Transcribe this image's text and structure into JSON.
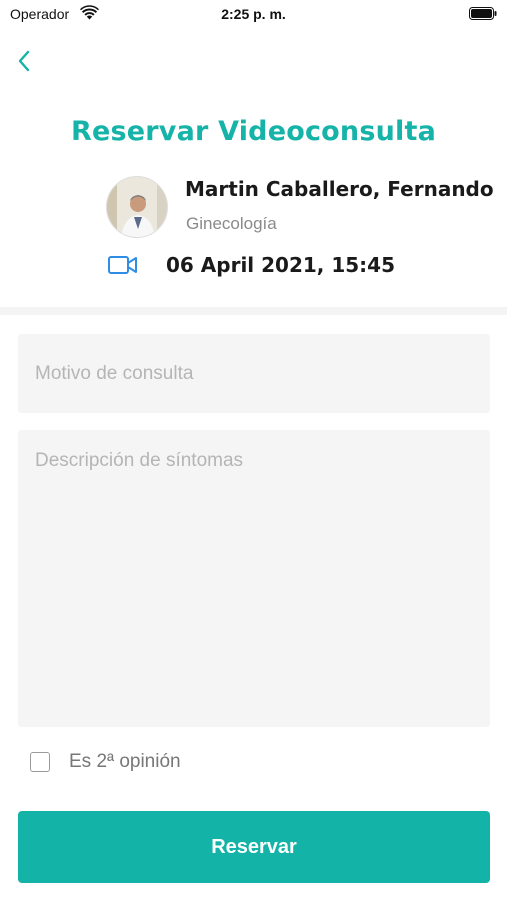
{
  "status_bar": {
    "carrier": "Operador",
    "time": "2:25 p. m."
  },
  "header": {
    "title": "Reservar Videoconsulta"
  },
  "doctor": {
    "name": "Martin Caballero, Fernando",
    "specialty": "Ginecología"
  },
  "appointment": {
    "datetime": "06 April 2021, 15:45",
    "type_icon": "video-camera-icon"
  },
  "form": {
    "motivo_placeholder": "Motivo de consulta",
    "motivo_value": "",
    "sintomas_placeholder": "Descripción de síntomas",
    "sintomas_value": "",
    "second_opinion_label": "Es 2ª opinión",
    "second_opinion_checked": false,
    "submit_label": "Reservar"
  },
  "colors": {
    "accent": "#13b3a8",
    "video_icon": "#2e8ee6"
  }
}
